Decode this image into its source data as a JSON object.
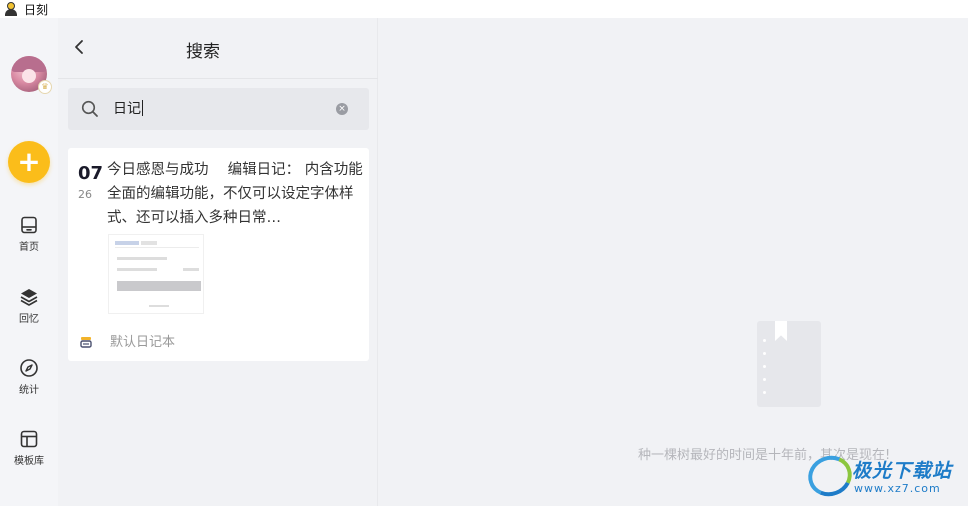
{
  "window": {
    "title": "日刻"
  },
  "rail": {
    "nav": [
      {
        "label": "首页",
        "icon": "home-icon"
      },
      {
        "label": "回忆",
        "icon": "layers-icon"
      },
      {
        "label": "统计",
        "icon": "compass-icon"
      },
      {
        "label": "模板库",
        "icon": "template-icon"
      }
    ],
    "add_icon": "+",
    "badge_icon": "♛"
  },
  "search_panel": {
    "title": "搜索",
    "query": "日记",
    "clear_icon": "×",
    "results": [
      {
        "day": "07",
        "month": "26",
        "text": "今日感恩与成功　 编辑日记： 内含功能全面的编辑功能，不仅可以设定字体样式、还可以插入多种日常…",
        "notebook": "默认日记本"
      }
    ]
  },
  "main": {
    "empty_text": "种一棵树最好的时间是十年前，其次是现在!"
  },
  "watermark": {
    "name": "极光下载站",
    "url": "www.xz7.com"
  },
  "colors": {
    "accent": "#fbbd1a",
    "background": "#f1f2f5"
  }
}
